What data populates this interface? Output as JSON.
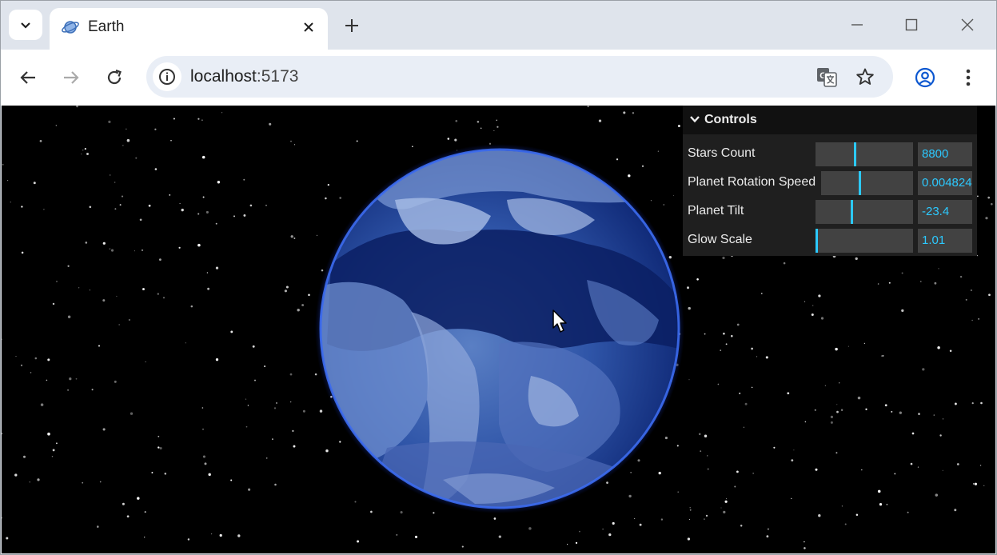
{
  "browser": {
    "tab": {
      "title": "Earth",
      "favicon": "planet-icon"
    },
    "icons": {
      "tab_search": "chevron-down-icon",
      "close_tab": "close-icon",
      "new_tab": "plus-icon",
      "minimize": "minimize-icon",
      "maximize": "maximize-icon",
      "close_window": "close-window-icon",
      "back": "back-arrow-icon",
      "forward": "forward-arrow-icon",
      "reload": "reload-icon",
      "site_info": "info-icon",
      "translate": "translate-icon",
      "bookmark": "star-icon",
      "profile": "profile-icon",
      "menu": "more-vert-icon"
    },
    "address": {
      "host": "localhost",
      "port": ":5173"
    }
  },
  "controls": {
    "title": "Controls",
    "rows": [
      {
        "label": "Stars Count",
        "value": "8800",
        "fill": 0.4
      },
      {
        "label": "Planet Rotation Speed",
        "value": "0.004824",
        "fill": 0.42
      },
      {
        "label": "Planet Tilt",
        "value": "-23.4",
        "fill": 0.37
      },
      {
        "label": "Glow Scale",
        "value": "1.01",
        "fill": 0.0
      }
    ]
  },
  "colors": {
    "accent": "#2cc9ff",
    "panel": "#1f1f1f",
    "slider_bg": "#424242"
  }
}
